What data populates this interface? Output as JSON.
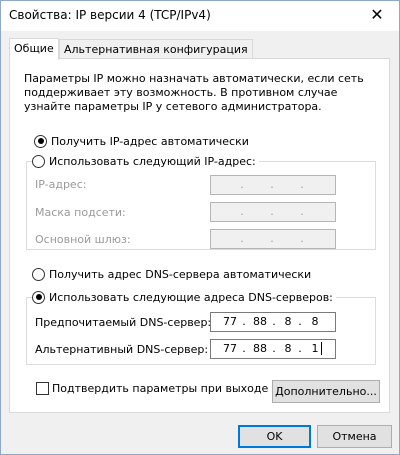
{
  "window": {
    "title": "Свойства: IP версии 4 (TCP/IPv4)",
    "close": "✕"
  },
  "tabs": [
    {
      "label": "Общие"
    },
    {
      "label": "Альтернативная конфигурация"
    }
  ],
  "description": "Параметры IP можно назначать автоматически, если сеть поддерживает эту возможность. В противном случае узнайте параметры IP у сетевого администратора.",
  "ip": {
    "auto_label": "Получить IP-адрес автоматически",
    "manual_label": "Использовать следующий IP-адрес:",
    "selected": "auto",
    "fields": [
      {
        "label": "IP-адрес:",
        "value": [
          ".",
          ".",
          "."
        ]
      },
      {
        "label": "Маска подсети:",
        "value": [
          ".",
          ".",
          "."
        ]
      },
      {
        "label": "Основной шлюз:",
        "value": [
          ".",
          ".",
          "."
        ]
      }
    ]
  },
  "dns": {
    "auto_label": "Получить адрес DNS-сервера автоматически",
    "manual_label": "Использовать следующие адреса DNS-серверов:",
    "selected": "manual",
    "preferred_label": "Предпочитаемый DNS-сервер:",
    "preferred_value": [
      "77",
      "88",
      "8",
      "8"
    ],
    "alternate_label": "Альтернативный DNS-сервер:",
    "alternate_value": [
      "77",
      "88",
      "8",
      "1"
    ]
  },
  "validate_label": "Подтвердить параметры при выходе",
  "advanced_button": "Дополнительно...",
  "ok_button": "OK",
  "cancel_button": "Отмена"
}
